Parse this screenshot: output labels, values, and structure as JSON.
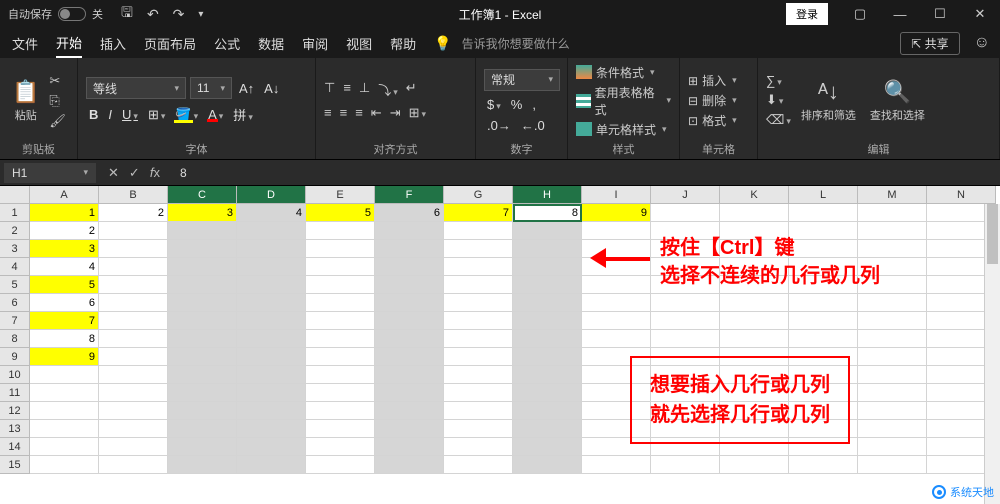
{
  "titlebar": {
    "autosave_label": "自动保存",
    "autosave_state": "关",
    "title": "工作簿1 - Excel",
    "login": "登录"
  },
  "tabs": {
    "items": [
      "文件",
      "开始",
      "插入",
      "页面布局",
      "公式",
      "数据",
      "审阅",
      "视图",
      "帮助"
    ],
    "active_index": 1,
    "tellme": "告诉我你想要做什么",
    "share": "共享"
  },
  "ribbon": {
    "clipboard": {
      "label": "剪贴板",
      "paste": "粘贴"
    },
    "font": {
      "label": "字体",
      "name": "等线",
      "size": "11"
    },
    "align": {
      "label": "对齐方式"
    },
    "number": {
      "label": "数字",
      "format": "常规"
    },
    "style": {
      "label": "样式",
      "cond": "条件格式",
      "table": "套用表格格式",
      "cell": "单元格样式"
    },
    "cells": {
      "label": "单元格",
      "insert": "插入",
      "delete": "删除",
      "format": "格式"
    },
    "edit": {
      "label": "编辑",
      "sort": "排序和筛选",
      "find": "查找和选择"
    }
  },
  "namebar": {
    "ref": "H1",
    "value": "8"
  },
  "columns": [
    "A",
    "B",
    "C",
    "D",
    "E",
    "F",
    "G",
    "H",
    "I",
    "J",
    "K",
    "L",
    "M",
    "N"
  ],
  "rows_shown": 15,
  "selected_cols": [
    "C",
    "D",
    "F",
    "H"
  ],
  "active_cell": "H1",
  "cell_data": {
    "A1": "1",
    "B1": "2",
    "C1": "3",
    "D1": "4",
    "E1": "5",
    "F1": "6",
    "G1": "7",
    "H1": "8",
    "I1": "9",
    "A2": "2",
    "A3": "3",
    "A4": "4",
    "A5": "5",
    "A6": "6",
    "A7": "7",
    "A8": "8",
    "A9": "9"
  },
  "yellow_cells": [
    "A1",
    "C1",
    "E1",
    "G1",
    "I1",
    "A3",
    "A5",
    "A7",
    "A9"
  ],
  "annotations": {
    "tip1_line1": "按住【Ctrl】键",
    "tip1_line2": "选择不连续的几行或几列",
    "tip2_line1": "想要插入几行或几列",
    "tip2_line2": "就先选择几行或几列"
  },
  "watermark": "系统天地"
}
